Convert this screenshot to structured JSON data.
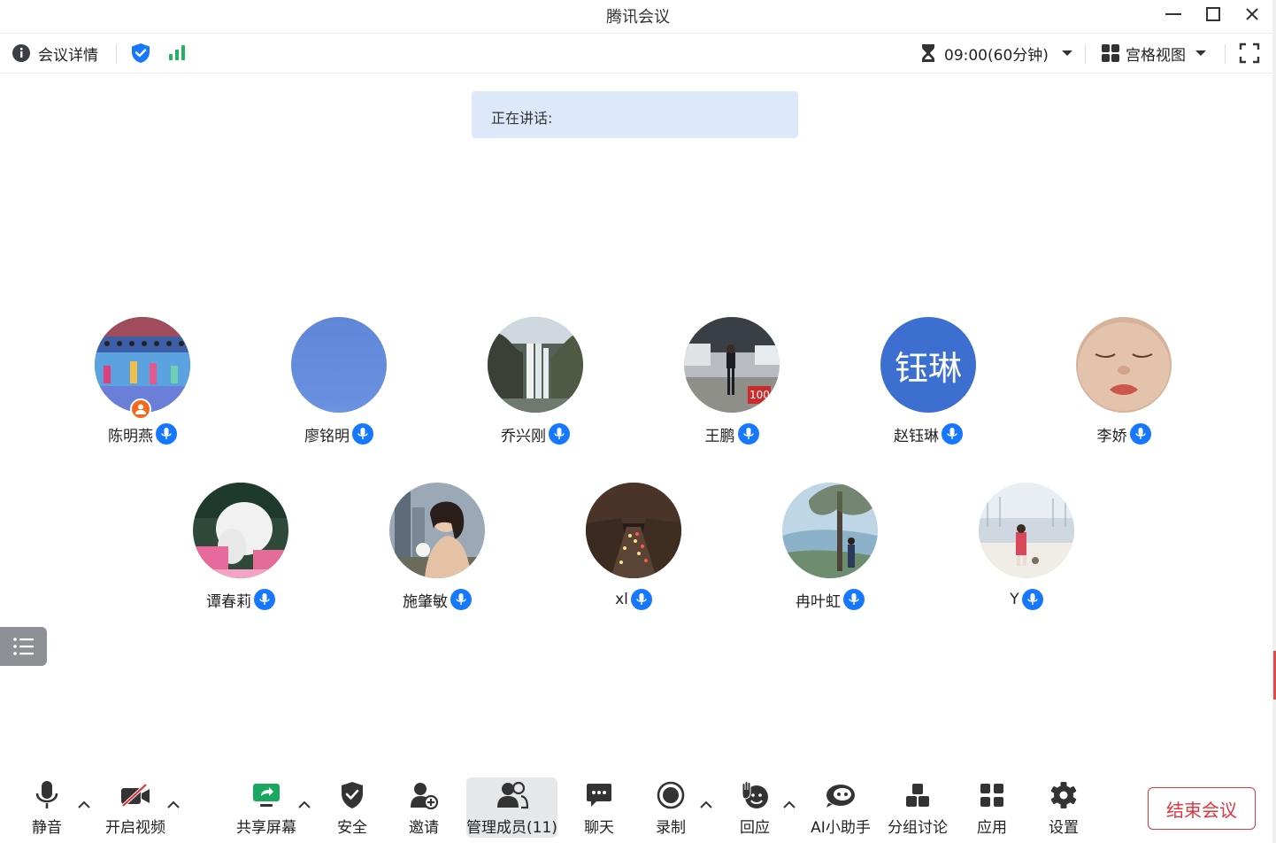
{
  "window": {
    "title": "腾讯会议"
  },
  "topbar": {
    "meeting_details_label": "会议详情",
    "time_label": "09:00(60分钟)",
    "view_label": "宫格视图"
  },
  "speaking": {
    "label": "正在讲话:"
  },
  "participants": [
    {
      "name": "陈明燕",
      "host": true
    },
    {
      "name": "廖铭明"
    },
    {
      "name": "乔兴刚"
    },
    {
      "name": "王鹏"
    },
    {
      "name": "赵钰琳",
      "avatar_text": "钰琳"
    },
    {
      "name": "李娇"
    },
    {
      "name": "谭春莉"
    },
    {
      "name": "施肇敏"
    },
    {
      "name": "xl"
    },
    {
      "name": "冉叶虹"
    },
    {
      "name": "Y"
    }
  ],
  "toolbar": {
    "mute_label": "静音",
    "video_label": "开启视频",
    "share_label": "共享屏幕",
    "security_label": "安全",
    "invite_label": "邀请",
    "members_label": "管理成员(11)",
    "chat_label": "聊天",
    "record_label": "录制",
    "react_label": "回应",
    "ai_label": "AI小助手",
    "breakout_label": "分组讨论",
    "apps_label": "应用",
    "settings_label": "设置",
    "end_label": "结束会议"
  },
  "colors": {
    "accent": "#1677ff",
    "end_red": "#e0353d",
    "signal_green": "#22b35e",
    "speaking_bg": "#dde9fb"
  }
}
